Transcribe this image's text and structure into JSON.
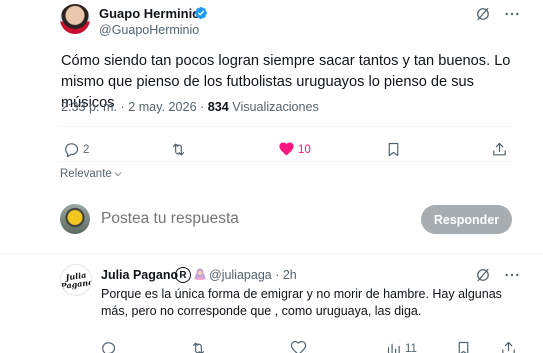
{
  "tweet": {
    "author_name": "Guapo Herminio",
    "author_handle": "@GuapoHerminio",
    "text": "Cómo siendo tan pocos logran siempre sacar tantos y tan buenos. Lo mismo que pienso de los futbolistas uruguayos lo pienso de sus músicos",
    "timestamp": "2:33 p. m. · 2 may. 2026 ·",
    "views_count": "834",
    "views_label": "Visualizaciones",
    "actions": {
      "replies": "2",
      "retweets": "",
      "likes": "10"
    }
  },
  "sort": {
    "label": "Relevante"
  },
  "compose": {
    "placeholder": "Postea tu respuesta",
    "button_label": "Responder"
  },
  "reply": {
    "author_name": "Julia Pagano",
    "badge": "R",
    "author_handle": "@juliapaga",
    "age": "· 2h",
    "avatar_text": "Julia Pagano",
    "text": "Porque es la única forma de emigrar y no morir de hambre. Hay algunas más, pero no corresponde que , como uruguaya, las diga.",
    "views_count": "11"
  },
  "colors": {
    "accent": "#1d9bf0",
    "like": "#f91880",
    "muted": "#536471"
  }
}
